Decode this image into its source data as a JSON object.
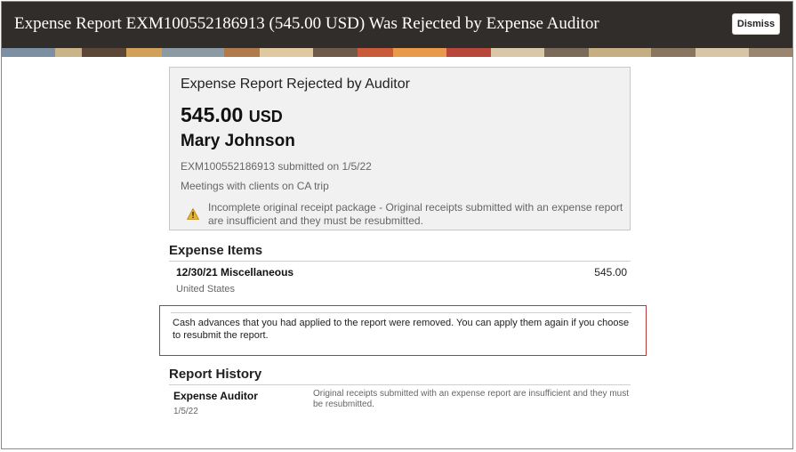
{
  "header": {
    "title": "Expense Report EXM100552186913 (545.00 USD) Was Rejected by Expense Auditor",
    "dismiss_label": "Dismiss"
  },
  "summary": {
    "heading": "Expense Report Rejected by Auditor",
    "amount": "545.00",
    "currency": "USD",
    "person": "Mary Johnson",
    "submitted": "EXM100552186913 submitted on 1/5/22",
    "purpose": "Meetings with clients on CA trip",
    "warning": "Incomplete original receipt package - Original receipts submitted with an expense report are insufficient and they must be resubmitted."
  },
  "expense_items": {
    "title": "Expense Items",
    "items": [
      {
        "title": "12/30/21 Miscellaneous",
        "amount": "545.00",
        "country": "United States"
      }
    ]
  },
  "notice": {
    "text": "Cash advances that you had applied to the report were removed. You can apply them again if you choose to resubmit the report."
  },
  "report_history": {
    "title": "Report History",
    "entries": [
      {
        "name": "Expense Auditor",
        "date": "1/5/22",
        "comment": "Original receipts submitted with an expense report are insufficient and they must be resubmitted."
      }
    ]
  },
  "icons": {
    "warning": "warning-triangle-icon"
  },
  "colors": {
    "header_bg": "#312d2a",
    "notice_border": "#b33a3a",
    "warning_icon": "#e8b52a"
  }
}
